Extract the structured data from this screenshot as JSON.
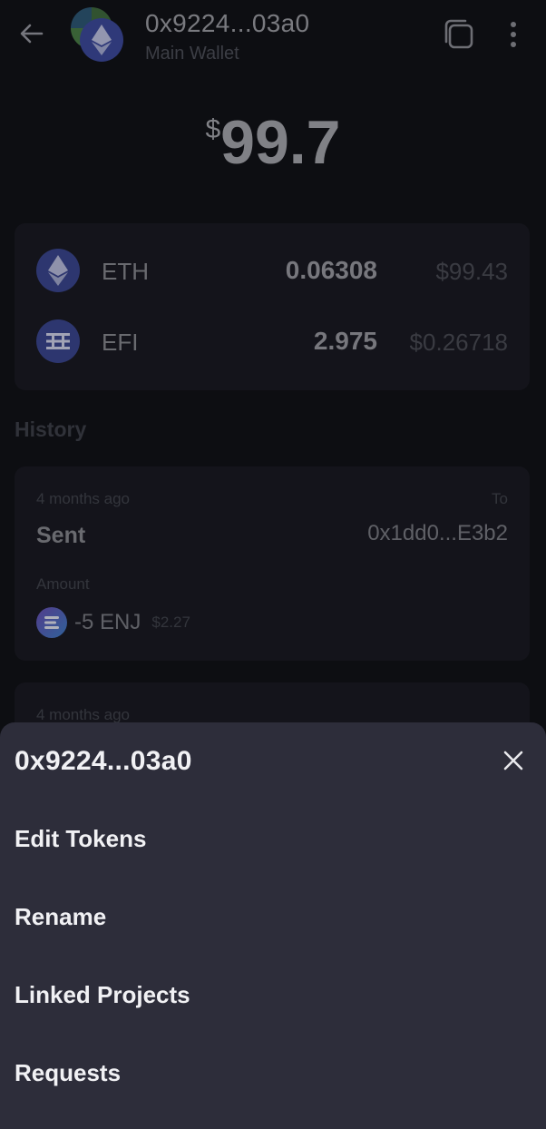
{
  "header": {
    "wallet_address": "0x9224...03a0",
    "wallet_name": "Main Wallet"
  },
  "balance": {
    "currency_symbol": "$",
    "amount": "99.7"
  },
  "tokens": [
    {
      "symbol": "ETH",
      "quantity": "0.06308",
      "usd_value": "$99.43",
      "icon": "ethereum-icon"
    },
    {
      "symbol": "EFI",
      "quantity": "2.975",
      "usd_value": "$0.26718",
      "icon": "efinity-icon"
    }
  ],
  "history": {
    "title": "History",
    "transactions": [
      {
        "time": "4 months ago",
        "type": "Sent",
        "to_label": "To",
        "to_address": "0x1dd0...E3b2",
        "amount_label": "Amount",
        "amount": "-5 ENJ",
        "amount_usd": "$2.27",
        "icon": "enjin-icon"
      },
      {
        "time": "4 months ago"
      }
    ]
  },
  "sheet": {
    "title": "0x9224...03a0",
    "items": [
      {
        "label": "Edit Tokens"
      },
      {
        "label": "Rename"
      },
      {
        "label": "Linked Projects"
      },
      {
        "label": "Requests"
      }
    ]
  },
  "colors": {
    "background": "#0f1015",
    "card": "#181920",
    "sheet": "#2d2d3a",
    "token_icon": "#3a4690",
    "sheet_text": "#f1f1f4"
  }
}
